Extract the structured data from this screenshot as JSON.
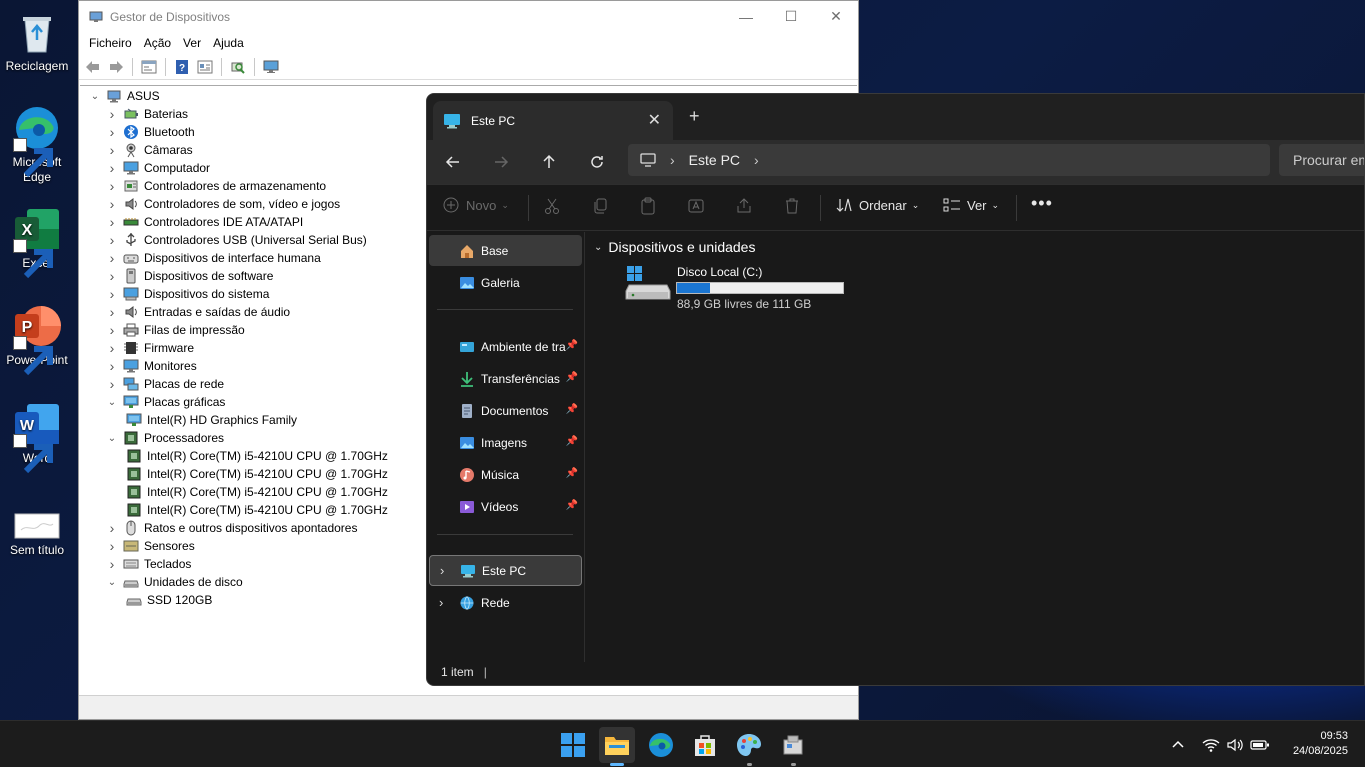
{
  "desktop": {
    "icons": [
      {
        "label": "Reciclagem"
      },
      {
        "label": "Microsoft Edge"
      },
      {
        "label": "Excel"
      },
      {
        "label": "PowerPoint"
      },
      {
        "label": "Word"
      },
      {
        "label": "Sem título"
      }
    ]
  },
  "device_manager": {
    "title": "Gestor de Dispositivos",
    "menu": [
      "Ficheiro",
      "Ação",
      "Ver",
      "Ajuda"
    ],
    "tree": [
      {
        "label": "ASUS",
        "level": 0,
        "state": "expanded",
        "icon": "computer-icon"
      },
      {
        "label": "Baterias",
        "level": 1,
        "state": "collapsed",
        "icon": "battery-icon"
      },
      {
        "label": "Bluetooth",
        "level": 1,
        "state": "collapsed",
        "icon": "bluetooth-icon"
      },
      {
        "label": "Câmaras",
        "level": 1,
        "state": "collapsed",
        "icon": "camera-icon"
      },
      {
        "label": "Computador",
        "level": 1,
        "state": "collapsed",
        "icon": "monitor-icon"
      },
      {
        "label": "Controladores de armazenamento",
        "level": 1,
        "state": "collapsed",
        "icon": "storage-controller-icon"
      },
      {
        "label": "Controladores de som, vídeo e jogos",
        "level": 1,
        "state": "collapsed",
        "icon": "speaker-icon"
      },
      {
        "label": "Controladores IDE ATA/ATAPI",
        "level": 1,
        "state": "collapsed",
        "icon": "ide-icon"
      },
      {
        "label": "Controladores USB (Universal Serial Bus)",
        "level": 1,
        "state": "collapsed",
        "icon": "usb-icon"
      },
      {
        "label": "Dispositivos de interface humana",
        "level": 1,
        "state": "collapsed",
        "icon": "hid-icon"
      },
      {
        "label": "Dispositivos de software",
        "level": 1,
        "state": "collapsed",
        "icon": "software-device-icon"
      },
      {
        "label": "Dispositivos do sistema",
        "level": 1,
        "state": "collapsed",
        "icon": "system-device-icon"
      },
      {
        "label": "Entradas e saídas de áudio",
        "level": 1,
        "state": "collapsed",
        "icon": "speaker-icon"
      },
      {
        "label": "Filas de impressão",
        "level": 1,
        "state": "collapsed",
        "icon": "printer-icon"
      },
      {
        "label": "Firmware",
        "level": 1,
        "state": "collapsed",
        "icon": "firmware-icon"
      },
      {
        "label": "Monitores",
        "level": 1,
        "state": "collapsed",
        "icon": "monitor-icon"
      },
      {
        "label": "Placas de rede",
        "level": 1,
        "state": "collapsed",
        "icon": "network-adapter-icon"
      },
      {
        "label": "Placas gráficas",
        "level": 1,
        "state": "expanded",
        "icon": "display-adapter-icon"
      },
      {
        "label": "Intel(R) HD Graphics Family",
        "level": 2,
        "state": "leaf",
        "icon": "display-adapter-icon"
      },
      {
        "label": "Processadores",
        "level": 1,
        "state": "expanded",
        "icon": "processor-icon"
      },
      {
        "label": "Intel(R) Core(TM) i5-4210U CPU @ 1.70GHz",
        "level": 2,
        "state": "leaf",
        "icon": "processor-icon"
      },
      {
        "label": "Intel(R) Core(TM) i5-4210U CPU @ 1.70GHz",
        "level": 2,
        "state": "leaf",
        "icon": "processor-icon"
      },
      {
        "label": "Intel(R) Core(TM) i5-4210U CPU @ 1.70GHz",
        "level": 2,
        "state": "leaf",
        "icon": "processor-icon"
      },
      {
        "label": "Intel(R) Core(TM) i5-4210U CPU @ 1.70GHz",
        "level": 2,
        "state": "leaf",
        "icon": "processor-icon"
      },
      {
        "label": "Ratos e outros dispositivos apontadores",
        "level": 1,
        "state": "collapsed",
        "icon": "mouse-icon"
      },
      {
        "label": "Sensores",
        "level": 1,
        "state": "collapsed",
        "icon": "sensor-icon"
      },
      {
        "label": "Teclados",
        "level": 1,
        "state": "collapsed",
        "icon": "keyboard-icon"
      },
      {
        "label": "Unidades de disco",
        "level": 1,
        "state": "expanded",
        "icon": "disk-icon"
      },
      {
        "label": "SSD 120GB",
        "level": 2,
        "state": "leaf",
        "icon": "disk-icon"
      }
    ]
  },
  "explorer": {
    "tab_title": "Este PC",
    "address": {
      "segments": [
        "Este PC"
      ]
    },
    "search_placeholder": "Procurar em",
    "commands": {
      "new": "Novo",
      "sort": "Ordenar",
      "view": "Ver"
    },
    "sidebar": {
      "top": [
        {
          "label": "Base",
          "icon": "home-icon",
          "selected": true
        },
        {
          "label": "Galeria",
          "icon": "gallery-icon"
        }
      ],
      "pinned": [
        {
          "label": "Ambiente de tra",
          "icon": "desktop-folder-icon"
        },
        {
          "label": "Transferências",
          "icon": "download-icon"
        },
        {
          "label": "Documentos",
          "icon": "documents-icon"
        },
        {
          "label": "Imagens",
          "icon": "pictures-icon"
        },
        {
          "label": "Música",
          "icon": "music-icon"
        },
        {
          "label": "Vídeos",
          "icon": "videos-icon"
        }
      ],
      "bottom": [
        {
          "label": "Este PC",
          "icon": "this-pc-icon",
          "selected": true
        },
        {
          "label": "Rede",
          "icon": "network-icon"
        }
      ]
    },
    "section_title": "Dispositivos e unidades",
    "drive": {
      "name": "Disco Local (C:)",
      "free_text": "88,9 GB livres de 111 GB",
      "used_fraction": 0.2
    },
    "status": "1 item"
  },
  "taskbar": {
    "apps": [
      "start-icon",
      "file-explorer-icon",
      "edge-icon",
      "store-icon",
      "paint-icon",
      "device-app-icon"
    ],
    "time": "09:53",
    "date": "24/08/2025"
  },
  "colors": {
    "accent": "#1a75d1",
    "explorer_bg": "#191919",
    "taskbar_bg": "#1c1c1c"
  }
}
